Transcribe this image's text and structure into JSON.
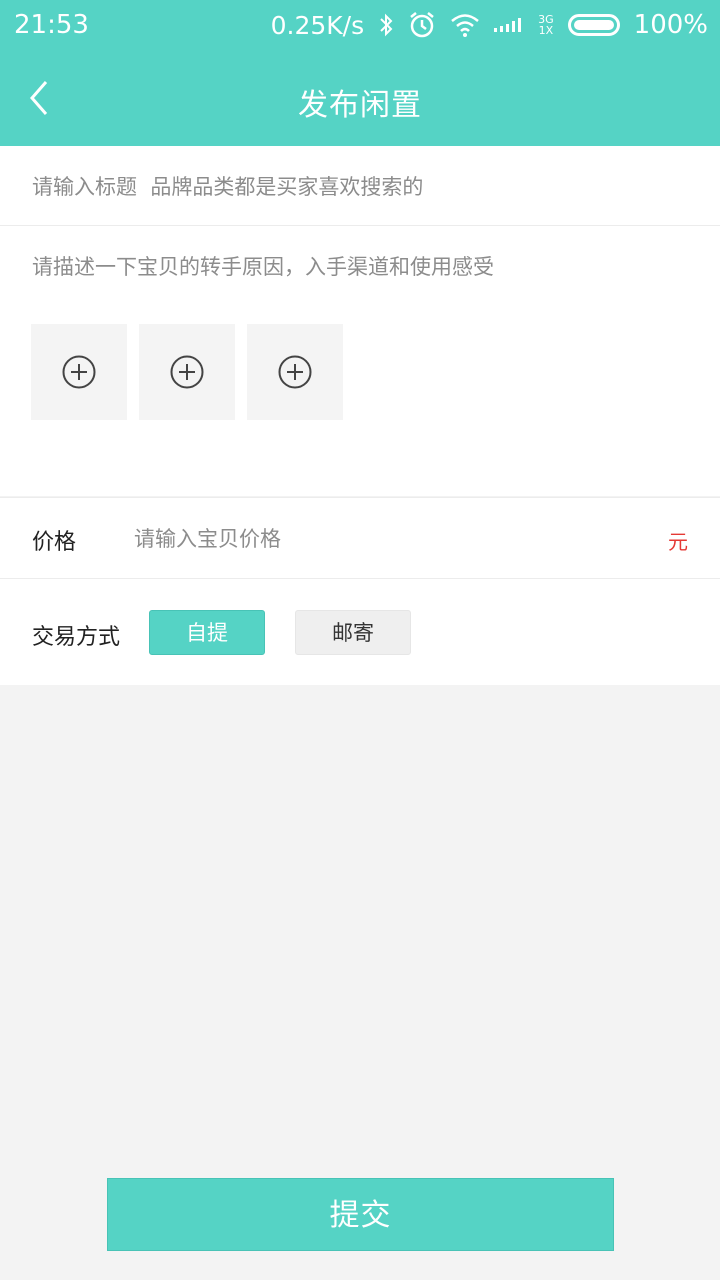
{
  "status_bar": {
    "time": "21:53",
    "net_speed": "0.25K/s",
    "signal_top": "3G",
    "signal_bottom": "1X",
    "battery": "100%"
  },
  "nav": {
    "title": "发布闲置"
  },
  "form": {
    "title_placeholder": "请输入标题  品牌品类都是买家喜欢搜索的",
    "description_placeholder": "请描述一下宝贝的转手原因，入手渠道和使用感受",
    "photo_slots": 3,
    "price_label": "价格",
    "price_placeholder": "请输入宝贝价格",
    "price_unit": "元",
    "trade_label": "交易方式",
    "trade_options": [
      "自提",
      "邮寄"
    ],
    "trade_selected": "自提"
  },
  "submit_label": "提交",
  "colors": {
    "accent": "#55d3c5",
    "price_unit": "#e53935",
    "background": "#f3f3f3"
  }
}
